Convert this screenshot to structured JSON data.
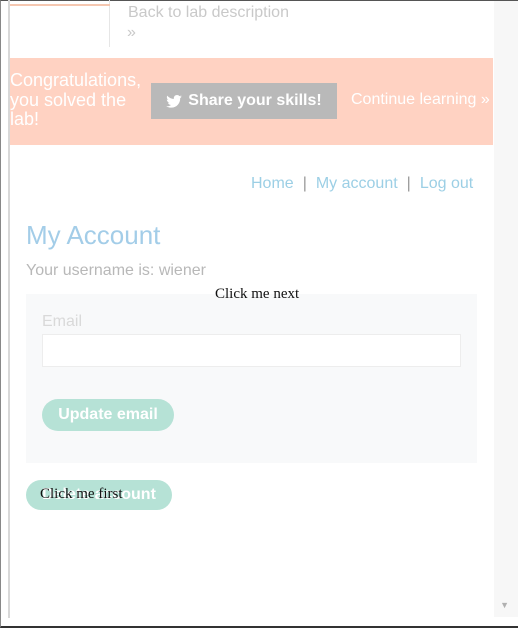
{
  "header": {
    "back_link": "Back to lab description",
    "back_chevron": "»"
  },
  "banner": {
    "message": "Congratulations, you solved the lab!",
    "share_label": "Share your skills!",
    "share_icon": "twitter-bird-icon",
    "continue_label": "Continue learning »"
  },
  "nav": {
    "home": "Home",
    "my_account": "My account",
    "log_out": "Log out",
    "separator": "|"
  },
  "main": {
    "title": "My Account",
    "username_text": "Your username is: wiener",
    "email_label": "Email",
    "email_value": "",
    "update_label": "Update email",
    "delete_label": "Delete account"
  },
  "overlay": {
    "next": "Click me next",
    "first": "Click me first"
  }
}
